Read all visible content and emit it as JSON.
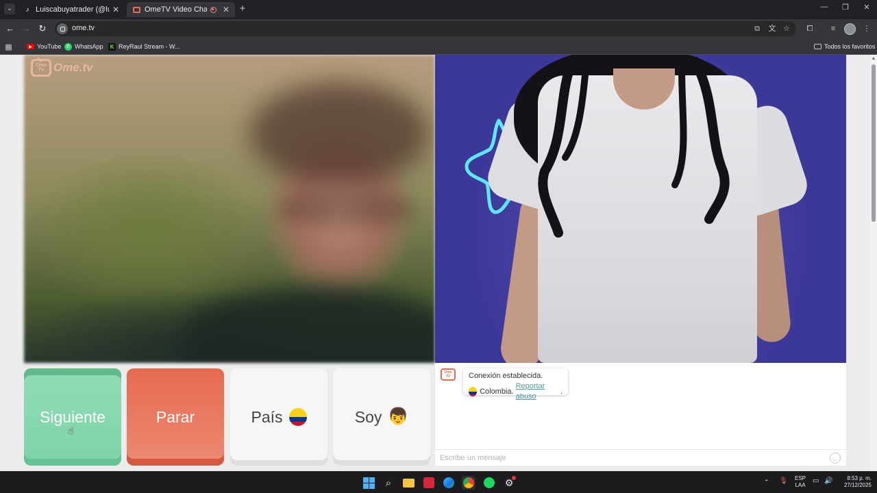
{
  "browser": {
    "tabs": [
      {
        "title": "Luiscabuyatrader (@luiscaforex",
        "active": false
      },
      {
        "title": "OmeTV Video Chat — Ome",
        "active": true
      }
    ],
    "new_tab": "+",
    "window_controls": {
      "minimize": "—",
      "restore": "❐",
      "close": "✕"
    },
    "url": "ome.tv",
    "bookmarks": [
      "YouTube",
      "WhatsApp",
      "ReyRaul Stream - W..."
    ],
    "bookmarks_folder": "Todos los favoritos"
  },
  "logo": {
    "tv_text": "Ome TV",
    "brand": "Ome.tv"
  },
  "controls": {
    "next_label": "Siguiente",
    "stop_label": "Parar",
    "country_label": "País",
    "gender_label": "Soy"
  },
  "chat": {
    "logo_text": "Ome TV",
    "connection_message": "Conexión establecida.",
    "country": "Colombia.",
    "report_link": "Reportar abuso",
    "report_suffix": ".",
    "input_placeholder": "Escribe un mensaje"
  },
  "taskbar": {
    "language": "ESP",
    "language_sub": "LAA",
    "time": "8:53 p. m.",
    "date": "27/12/2025"
  },
  "colors": {
    "next_green": "#7fd3a9",
    "stop_red": "#e66b4f",
    "link_teal": "#4a9aa2",
    "logo_pink": "#e8b7a4"
  }
}
